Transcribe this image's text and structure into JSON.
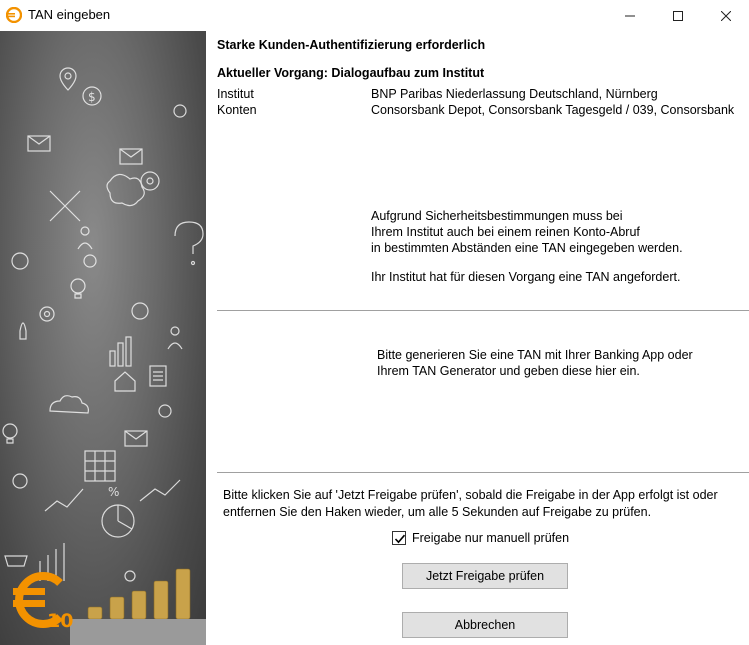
{
  "window": {
    "title": "TAN eingeben",
    "icon_text": "€"
  },
  "branding": {
    "logo_symbol": "€",
    "logo_number": "10",
    "logo_color": "#f39200"
  },
  "content": {
    "heading": "Starke Kunden-Authentifizierung erforderlich",
    "current_process": "Aktueller Vorgang: Dialogaufbau zum Institut",
    "fields": [
      {
        "label": "Institut",
        "value": "BNP Paribas Niederlassung Deutschland, Nürnberg"
      },
      {
        "label": "Konten",
        "value": "Consorsbank Depot, Consorsbank Tagesgeld / 039, Consorsbank"
      }
    ],
    "info_lines": [
      "Aufgrund Sicherheitsbestimmungen muss bei",
      "Ihrem Institut auch bei einem reinen Konto-Abruf",
      "in bestimmten Abständen eine TAN eingegeben werden."
    ],
    "tan_requested": "Ihr Institut hat für diesen Vorgang eine TAN angefordert.",
    "instruction_lines": [
      "Bitte generieren Sie eine TAN mit Ihrer Banking App oder",
      "Ihrem TAN Generator und geben diese hier ein."
    ],
    "approval_lines": [
      "Bitte klicken Sie auf 'Jetzt Freigabe prüfen', sobald die Freigabe in der App erfolgt ist oder",
      "entfernen Sie den Haken wieder, um alle 5 Sekunden auf Freigabe zu prüfen."
    ],
    "manual_check": {
      "label": "Freigabe nur manuell prüfen",
      "checked": true
    },
    "check_button": "Jetzt Freigabe prüfen",
    "cancel_button": "Abbrechen"
  }
}
